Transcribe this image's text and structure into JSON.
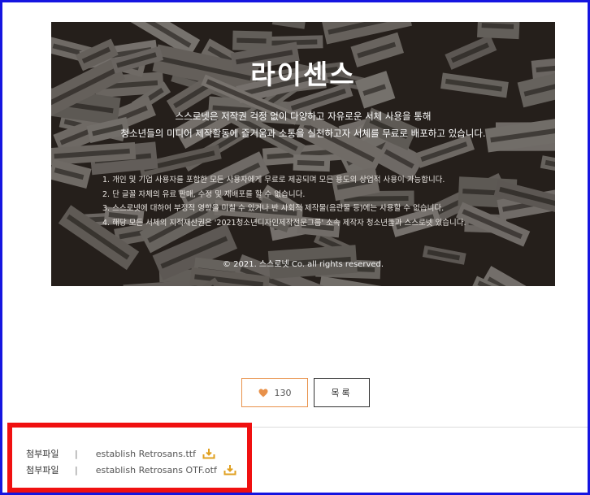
{
  "banner": {
    "title": "라이센스",
    "intro_line1": "스스로넷은 저작권 걱정 없이 다양하고 자유로운 서체 사용을 통해",
    "intro_line2": "청소년들의 미디어 제작활동에 즐거움과 소통을 실천하고자 서체를 무료로 배포하고 있습니다.",
    "rules": [
      "1. 개인 및 기업 사용자를 포함한 모든 사용자에게 무료로 제공되며 모든 용도의 상업적 사용이 가능합니다.",
      "2. 단 글꼴 자체의 유료 판매, 수정 및 재배포를 할 수 없습니다.",
      "3. 스스로넷에 대하여 부정적 영향을 미칠 수 있거나 반 사회적 제작물(음란물 등)에는 사용할 수 없습니다.",
      "4. 해당 모든 서체의 지적재산권은 '2021청소년디자인제작전문그룹' 소속 제작자 청소년들과 스스로넷 있습니다."
    ],
    "copyright": "© 2021. 스스로넷 Co. all rights reserved."
  },
  "actions": {
    "like_count": "130",
    "list_label": "목록"
  },
  "attachments": [
    {
      "label": "첨부파일",
      "separator": "|",
      "filename": "establish Retrosans.ttf",
      "icon": "download-icon"
    },
    {
      "label": "첨부파일",
      "separator": "|",
      "filename": "establish Retrosans OTF.otf",
      "icon": "download-icon"
    }
  ],
  "colors": {
    "accent": "#e8914a",
    "download_icon": "#e0a020",
    "highlight_box": "#f01010",
    "window_border": "#1515e0"
  }
}
